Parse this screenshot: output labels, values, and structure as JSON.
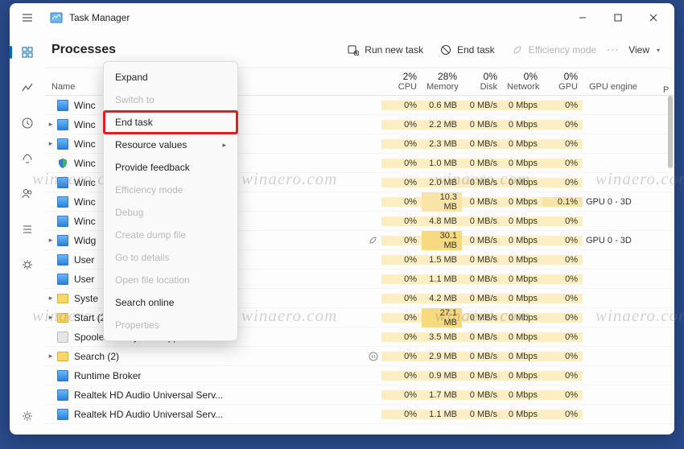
{
  "app": {
    "title": "Task Manager"
  },
  "toolbar": {
    "page_title": "Processes",
    "run_new_task": "Run new task",
    "end_task": "End task",
    "efficiency_mode": "Efficiency mode",
    "view": "View"
  },
  "columns": {
    "name": "Name",
    "cpu": {
      "pct": "2%",
      "label": "CPU"
    },
    "memory": {
      "pct": "28%",
      "label": "Memory"
    },
    "disk": {
      "pct": "0%",
      "label": "Disk"
    },
    "network": {
      "pct": "0%",
      "label": "Network"
    },
    "gpu": {
      "pct": "0%",
      "label": "GPU"
    },
    "gpu_engine": "GPU engine",
    "p": "P"
  },
  "rows": [
    {
      "expand": false,
      "icon": "blue",
      "name": "Winc",
      "cpu": "0%",
      "mem": "0.6 MB",
      "disk": "0 MB/s",
      "net": "0 Mbps",
      "gpu": "0%",
      "gpu_eng": ""
    },
    {
      "expand": true,
      "icon": "blue",
      "name": "Winc",
      "cpu": "0%",
      "mem": "2.2 MB",
      "disk": "0 MB/s",
      "net": "0 Mbps",
      "gpu": "0%",
      "gpu_eng": ""
    },
    {
      "expand": true,
      "icon": "blue",
      "name": "Winc",
      "cpu": "0%",
      "mem": "2.3 MB",
      "disk": "0 MB/s",
      "net": "0 Mbps",
      "gpu": "0%",
      "gpu_eng": ""
    },
    {
      "expand": false,
      "icon": "shield",
      "name": "Winc",
      "cpu": "0%",
      "mem": "1.0 MB",
      "disk": "0 MB/s",
      "net": "0 Mbps",
      "gpu": "0%",
      "gpu_eng": ""
    },
    {
      "expand": false,
      "icon": "blue",
      "name": "Winc",
      "cpu": "0%",
      "mem": "2.0 MB",
      "disk": "0 MB/s",
      "net": "0 Mbps",
      "gpu": "0%",
      "gpu_eng": ""
    },
    {
      "expand": false,
      "icon": "blue",
      "name": "Winc",
      "cpu": "0%",
      "mem": "10.3 MB",
      "disk": "0 MB/s",
      "net": "0 Mbps",
      "gpu": "0.1%",
      "gpu_eng": "GPU 0 - 3D",
      "gpu_hi": true
    },
    {
      "expand": false,
      "icon": "blue",
      "name": "Winc",
      "cpu": "0%",
      "mem": "4.8 MB",
      "disk": "0 MB/s",
      "net": "0 Mbps",
      "gpu": "0%",
      "gpu_eng": ""
    },
    {
      "expand": true,
      "icon": "blue",
      "name": "Widg",
      "status": "leaf",
      "cpu": "0%",
      "mem": "30.1 MB",
      "disk": "0 MB/s",
      "net": "0 Mbps",
      "gpu": "0%",
      "gpu_eng": "GPU 0 - 3D"
    },
    {
      "expand": false,
      "icon": "blue",
      "name": "User",
      "cpu": "0%",
      "mem": "1.5 MB",
      "disk": "0 MB/s",
      "net": "0 Mbps",
      "gpu": "0%",
      "gpu_eng": ""
    },
    {
      "expand": false,
      "icon": "blue",
      "name": "User",
      "cpu": "0%",
      "mem": "1.1 MB",
      "disk": "0 MB/s",
      "net": "0 Mbps",
      "gpu": "0%",
      "gpu_eng": ""
    },
    {
      "expand": true,
      "icon": "folder",
      "name": "Syste",
      "cpu": "0%",
      "mem": "4.2 MB",
      "disk": "0 MB/s",
      "net": "0 Mbps",
      "gpu": "0%",
      "gpu_eng": ""
    },
    {
      "expand": true,
      "icon": "folder",
      "name": "Start (2)",
      "cpu": "0%",
      "mem": "27.1 MB",
      "disk": "0 MB/s",
      "net": "0 Mbps",
      "gpu": "0%",
      "gpu_eng": ""
    },
    {
      "expand": false,
      "icon": "app",
      "name": "Spooler SubSystem App",
      "cpu": "0%",
      "mem": "3.5 MB",
      "disk": "0 MB/s",
      "net": "0 Mbps",
      "gpu": "0%",
      "gpu_eng": ""
    },
    {
      "expand": true,
      "icon": "folder",
      "name": "Search (2)",
      "status": "pause",
      "cpu": "0%",
      "mem": "2.9 MB",
      "disk": "0 MB/s",
      "net": "0 Mbps",
      "gpu": "0%",
      "gpu_eng": ""
    },
    {
      "expand": false,
      "icon": "blue",
      "name": "Runtime Broker",
      "cpu": "0%",
      "mem": "0.9 MB",
      "disk": "0 MB/s",
      "net": "0 Mbps",
      "gpu": "0%",
      "gpu_eng": ""
    },
    {
      "expand": false,
      "icon": "blue",
      "name": "Realtek HD Audio Universal Serv...",
      "cpu": "0%",
      "mem": "1.7 MB",
      "disk": "0 MB/s",
      "net": "0 Mbps",
      "gpu": "0%",
      "gpu_eng": ""
    },
    {
      "expand": false,
      "icon": "blue",
      "name": "Realtek HD Audio Universal Serv...",
      "cpu": "0%",
      "mem": "1.1 MB",
      "disk": "0 MB/s",
      "net": "0 Mbps",
      "gpu": "0%",
      "gpu_eng": ""
    }
  ],
  "context_menu": {
    "expand": "Expand",
    "switch_to": "Switch to",
    "end_task": "End task",
    "resource_values": "Resource values",
    "provide_feedback": "Provide feedback",
    "efficiency_mode": "Efficiency mode",
    "debug": "Debug",
    "create_dump_file": "Create dump file",
    "go_to_details": "Go to details",
    "open_file_location": "Open file location",
    "search_online": "Search online",
    "properties": "Properties"
  },
  "watermark": "winaero.com"
}
